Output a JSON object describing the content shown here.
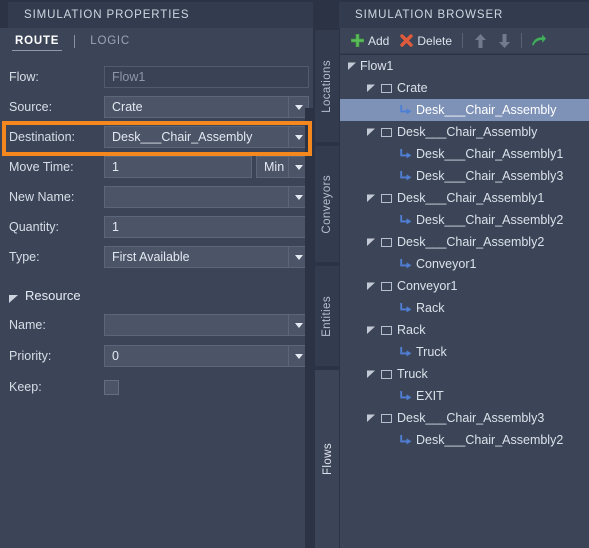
{
  "properties_panel": {
    "title": "SIMULATION PROPERTIES",
    "tabs": [
      {
        "label": "ROUTE",
        "active": true
      },
      {
        "label": "LOGIC",
        "active": false
      }
    ],
    "fields": [
      {
        "label": "Flow:",
        "value": "Flow1",
        "type": "readonly"
      },
      {
        "label": "Source:",
        "value": "Crate",
        "type": "combo"
      },
      {
        "label": "Destination:",
        "value": "Desk___Chair_Assembly",
        "type": "combo"
      },
      {
        "label": "Move Time:",
        "value": "1",
        "type": "text-with-unit",
        "unit": "Min"
      },
      {
        "label": "New Name:",
        "value": "",
        "type": "combo",
        "highlighted": true
      },
      {
        "label": "Quantity:",
        "value": "1",
        "type": "text"
      },
      {
        "label": "Type:",
        "value": "First Available",
        "type": "combo"
      }
    ],
    "resource_section": {
      "title": "Resource",
      "expanded": true,
      "fields": [
        {
          "label": "Name:",
          "value": "",
          "type": "combo"
        },
        {
          "label": "Priority:",
          "value": "0",
          "type": "combo"
        },
        {
          "label": "Keep:",
          "value": "",
          "type": "checkbox",
          "checked": false
        }
      ]
    },
    "highlight_color": "#f5871f"
  },
  "vertical_tabs": [
    {
      "label": "Locations",
      "active": false
    },
    {
      "label": "Conveyors",
      "active": false
    },
    {
      "label": "Entities",
      "active": false
    },
    {
      "label": "Flows",
      "active": true
    }
  ],
  "browser_panel": {
    "title": "SIMULATION BROWSER",
    "toolbar": {
      "add_label": "Add",
      "add_icon": "plus-icon",
      "delete_label": "Delete",
      "delete_icon": "cross-icon",
      "move_up_icon": "arrow-up-icon",
      "move_down_icon": "arrow-down-icon",
      "goto_icon": "arrow-right-curved-icon"
    },
    "tree": [
      {
        "label": "Flow1",
        "depth": 0,
        "icon": "none",
        "expander": "expanded",
        "selected": false
      },
      {
        "label": "Crate",
        "depth": 1,
        "icon": "square",
        "expander": "expanded",
        "selected": false
      },
      {
        "label": "Desk___Chair_Assembly",
        "depth": 2,
        "icon": "route",
        "expander": "none",
        "selected": true
      },
      {
        "label": "Desk___Chair_Assembly",
        "depth": 1,
        "icon": "square",
        "expander": "expanded",
        "selected": false
      },
      {
        "label": "Desk___Chair_Assembly1",
        "depth": 2,
        "icon": "route",
        "expander": "none",
        "selected": false
      },
      {
        "label": "Desk___Chair_Assembly3",
        "depth": 2,
        "icon": "route",
        "expander": "none",
        "selected": false
      },
      {
        "label": "Desk___Chair_Assembly1",
        "depth": 1,
        "icon": "square",
        "expander": "expanded",
        "selected": false
      },
      {
        "label": "Desk___Chair_Assembly2",
        "depth": 2,
        "icon": "route",
        "expander": "none",
        "selected": false
      },
      {
        "label": "Desk___Chair_Assembly2",
        "depth": 1,
        "icon": "square",
        "expander": "expanded",
        "selected": false
      },
      {
        "label": "Conveyor1",
        "depth": 2,
        "icon": "route",
        "expander": "none",
        "selected": false
      },
      {
        "label": "Conveyor1",
        "depth": 1,
        "icon": "square",
        "expander": "expanded",
        "selected": false
      },
      {
        "label": "Rack",
        "depth": 2,
        "icon": "route",
        "expander": "none",
        "selected": false
      },
      {
        "label": "Rack",
        "depth": 1,
        "icon": "square",
        "expander": "expanded",
        "selected": false
      },
      {
        "label": "Truck",
        "depth": 2,
        "icon": "route",
        "expander": "none",
        "selected": false
      },
      {
        "label": "Truck",
        "depth": 1,
        "icon": "square",
        "expander": "expanded",
        "selected": false
      },
      {
        "label": "EXIT",
        "depth": 2,
        "icon": "route",
        "expander": "none",
        "selected": false
      },
      {
        "label": "Desk___Chair_Assembly3",
        "depth": 1,
        "icon": "square",
        "expander": "expanded",
        "selected": false
      },
      {
        "label": "Desk___Chair_Assembly2",
        "depth": 2,
        "icon": "route",
        "expander": "none",
        "selected": false
      }
    ]
  }
}
